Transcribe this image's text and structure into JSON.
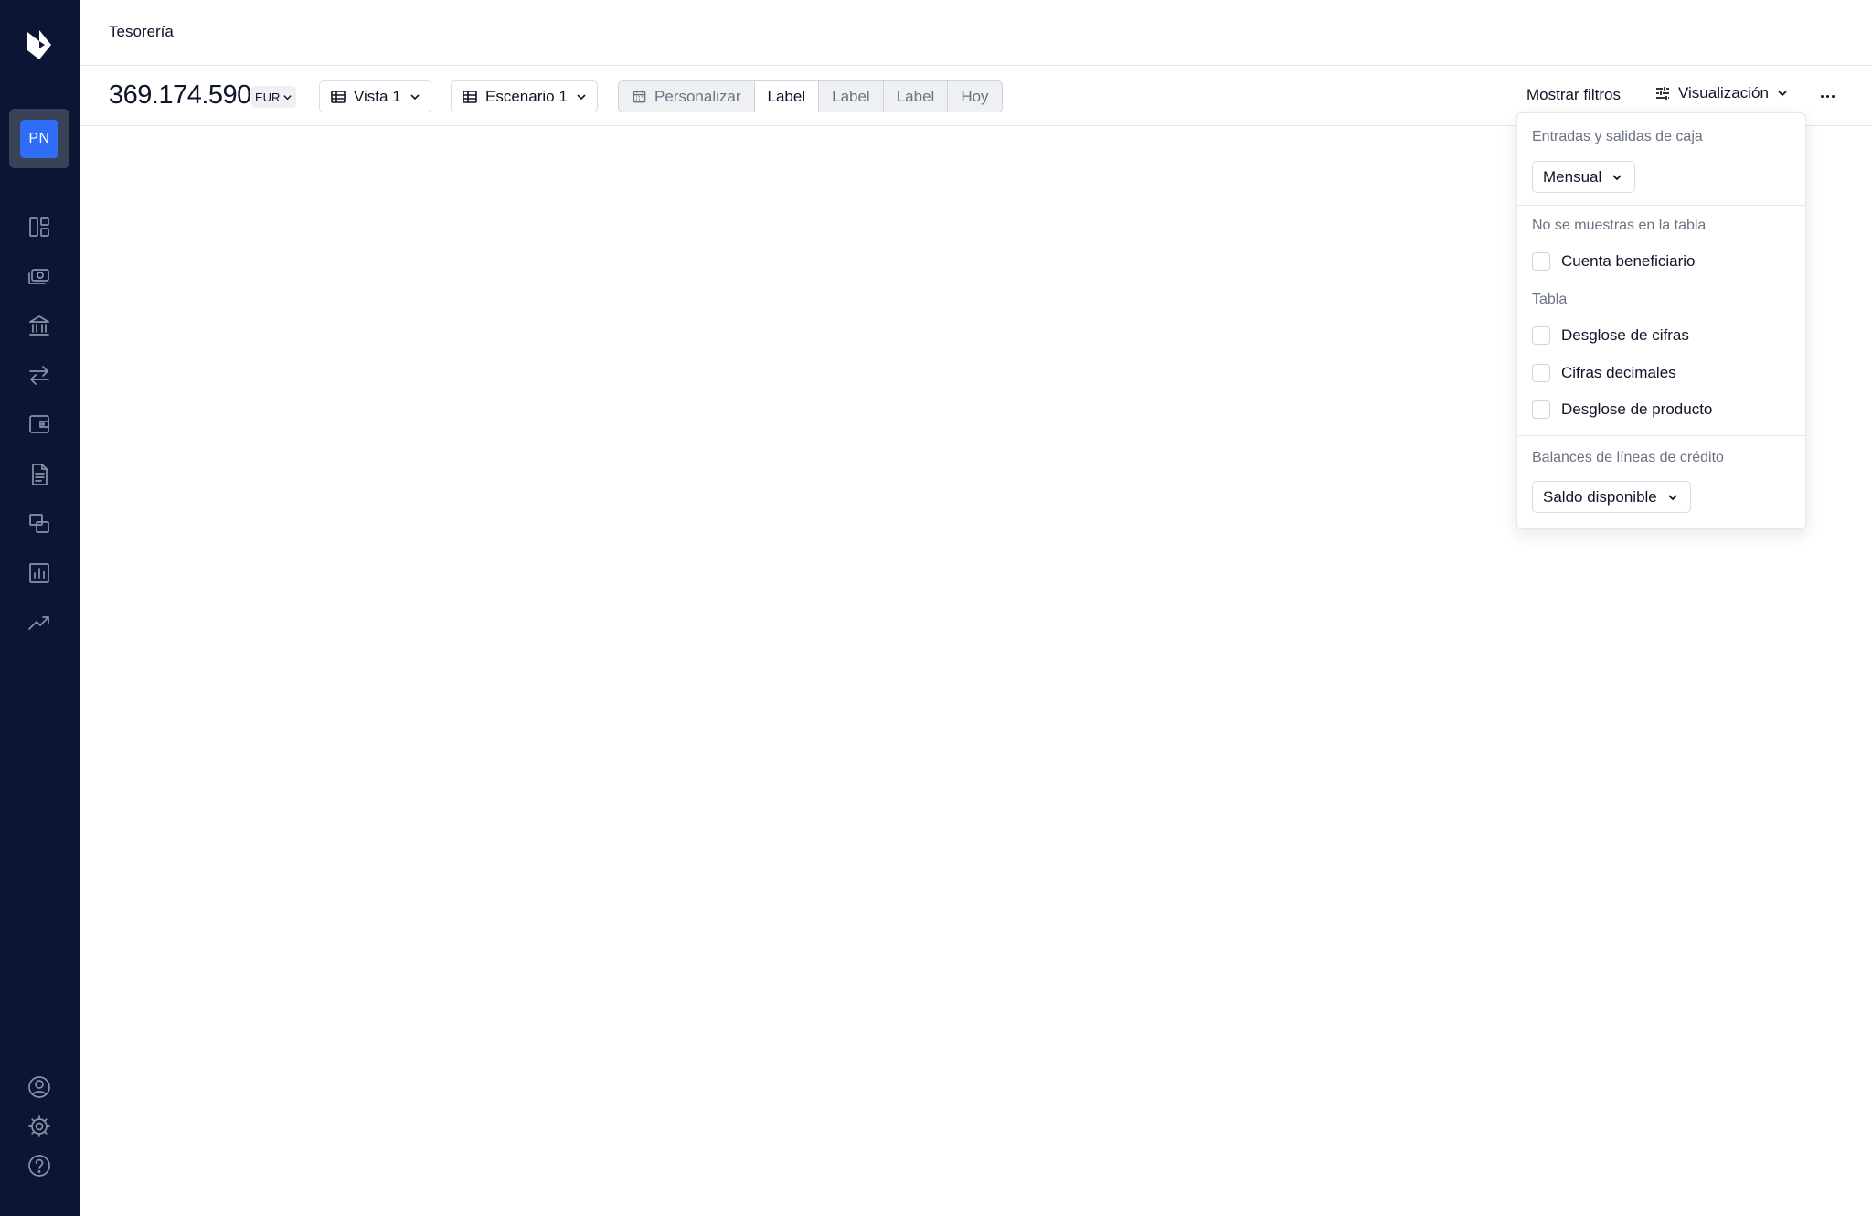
{
  "header": {
    "title": "Tesorería"
  },
  "sidebar": {
    "avatar_initials": "PN",
    "items": [
      {
        "icon": "dashboard-icon"
      },
      {
        "icon": "money-icon"
      },
      {
        "icon": "bank-icon"
      },
      {
        "icon": "transfer-icon"
      },
      {
        "icon": "wallet-icon"
      },
      {
        "icon": "document-icon"
      },
      {
        "icon": "reconcile-icon"
      },
      {
        "icon": "chart-bar-icon"
      },
      {
        "icon": "trending-icon"
      }
    ],
    "bottom": [
      {
        "icon": "user-circle-icon"
      },
      {
        "icon": "gear-icon"
      },
      {
        "icon": "help-icon"
      }
    ]
  },
  "toolbar": {
    "balance": "369.174.590",
    "currency": "EUR",
    "view_label": "Vista 1",
    "scenario_label": "Escenario 1",
    "segments": {
      "custom": "Personalizar",
      "label1": "Label",
      "label2": "Label",
      "label3": "Label",
      "today": "Hoy"
    },
    "show_filters": "Mostrar filtros",
    "visualization": "Visualización"
  },
  "panel": {
    "cash_flow_label": "Entradas y salidas de caja",
    "cash_flow_value": "Mensual",
    "not_shown_label": "No se muestras en la tabla",
    "beneficiary": "Cuenta beneficiario",
    "table_label": "Tabla",
    "figures_breakdown": "Desglose de cifras",
    "decimals": "Cifras decimales",
    "product_breakdown": "Desglose de producto",
    "credit_label": "Balances de líneas de crédito",
    "credit_value": "Saldo disponible"
  },
  "colors": {
    "sidebar_bg": "#0d1535",
    "accent": "#2f6df6",
    "text": "#0f1529",
    "muted": "#6b7285"
  }
}
